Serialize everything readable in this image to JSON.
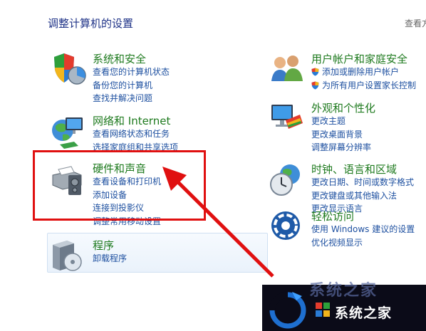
{
  "header": {
    "title": "调整计算机的设置",
    "view_by": "查看方"
  },
  "categories": [
    {
      "title": "系统和安全",
      "icon": "shield-pc-icon",
      "links": [
        "查看您的计算机状态",
        "备份您的计算机",
        "查找并解决问题"
      ]
    },
    {
      "title": "网络和 Internet",
      "icon": "network-globe-icon",
      "links": [
        "查看网络状态和任务",
        "选择家庭组和共享选项"
      ]
    },
    {
      "title": "硬件和声音",
      "icon": "printer-speaker-icon",
      "links": [
        "查看设备和打印机",
        "添加设备",
        "连接到投影仪",
        "调整常用移动设置"
      ]
    },
    {
      "title": "程序",
      "icon": "programs-box-icon",
      "links": [
        "卸载程序"
      ]
    },
    {
      "title": "用户帐户和家庭安全",
      "icon": "users-icon",
      "links": [
        "添加或删除用户帐户",
        "为所有用户设置家长控制"
      ]
    },
    {
      "title": "外观和个性化",
      "icon": "monitor-palette-icon",
      "links": [
        "更改主题",
        "更改桌面背景",
        "调整屏幕分辨率"
      ]
    },
    {
      "title": "时钟、语言和区域",
      "icon": "clock-globe-icon",
      "links": [
        "更改日期、时间或数字格式",
        "更改键盘或其他输入法",
        "更改显示语言"
      ]
    },
    {
      "title": "轻松访问",
      "icon": "ease-of-access-icon",
      "links": [
        "使用 Windows 建议的设置",
        "优化视频显示"
      ]
    }
  ],
  "watermark": {
    "top_text": "系统之家",
    "text": "系统之家"
  },
  "colors": {
    "category_title": "#1e7a1e",
    "link": "#1e50a0",
    "highlight": "#e01010",
    "header": "#1e3287"
  }
}
